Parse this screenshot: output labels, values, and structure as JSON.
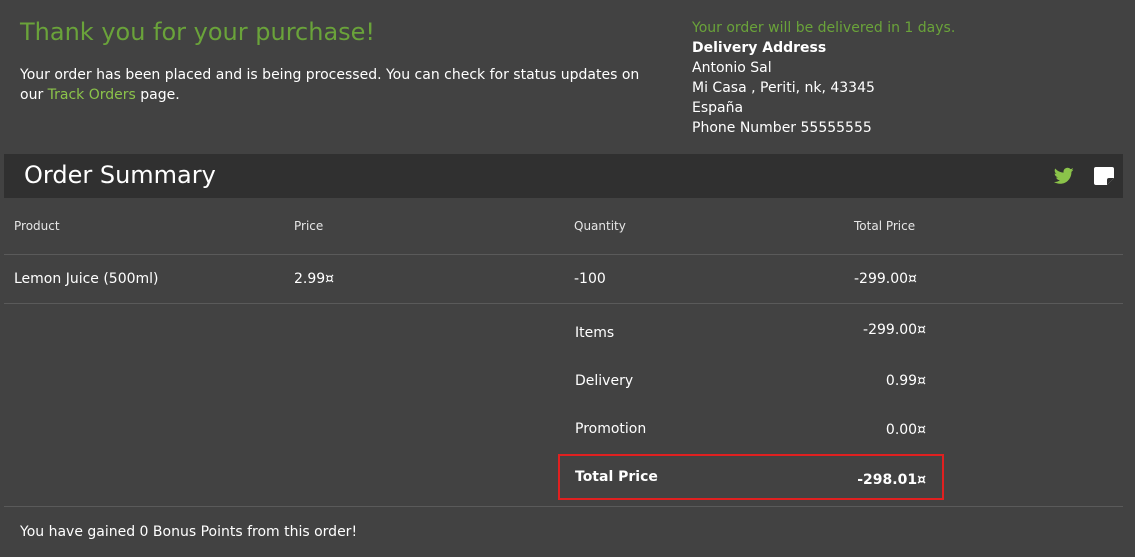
{
  "confirmation": {
    "title": "Thank you for your purchase!",
    "text_before": "Your order has been placed and is being processed. You can check for status updates on our",
    "link_label": "Track Orders",
    "text_after": "page."
  },
  "delivery": {
    "eta": "Your order will be delivered in 1 days.",
    "address_title": "Delivery Address",
    "name": "Antonio Sal",
    "street": "Mi Casa , Periti, nk, 43345",
    "country": "España",
    "phone": "Phone Number 55555555"
  },
  "summary": {
    "title": "Order Summary",
    "icons": [
      "twitter-icon",
      "save-icon"
    ],
    "accent_color": "#8bc34a"
  },
  "table": {
    "headers": [
      "Product",
      "Price",
      "Quantity",
      "Total Price"
    ],
    "rows": [
      {
        "product": "Lemon Juice (500ml)",
        "price": "2.99¤",
        "quantity": "-100",
        "total": "-299.00¤"
      }
    ]
  },
  "totals": {
    "items_label": "Items",
    "items_value": "-299.00¤",
    "delivery_label": "Delivery",
    "delivery_value": "0.99¤",
    "promotion_label": "Promotion",
    "promotion_value": "0.00¤",
    "total_label": "Total Price",
    "total_value": "-298.01¤",
    "highlight_color": "#e02020"
  },
  "bonus": {
    "text": "You have gained 0 Bonus Points from this order!"
  }
}
